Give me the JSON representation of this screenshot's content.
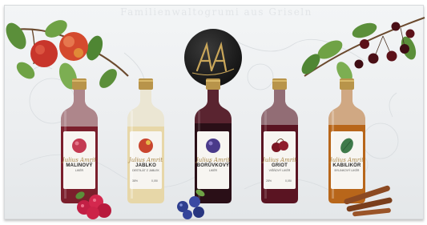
{
  "box": {
    "top_text": "Familienwaltogrumi aus Griseln",
    "logo_text": "AA"
  },
  "bottles": [
    {
      "name": "MALINOVÝ",
      "sub": "LIKÉR",
      "pct": "",
      "volume": "",
      "liquid": "#7b1f2c",
      "fruit": "raspberry-icon"
    },
    {
      "name": "JABLKO",
      "sub": "DESTILÁT Z JABLEK",
      "pct": "38%",
      "volume": "0,05l",
      "liquid": "#e7d7a8",
      "fruit": "apple-icon"
    },
    {
      "name": "BORŮVKOVÝ",
      "sub": "LIKÉR",
      "pct": "",
      "volume": "",
      "liquid": "#2a0f17",
      "fruit": "blueberry-icon"
    },
    {
      "name": "GRIOT",
      "sub": "VIŠŇOVÝ LIKÉR",
      "pct": "28%",
      "volume": "0,05l",
      "liquid": "#5a1422",
      "fruit": "cherry-icon"
    },
    {
      "name": "KABILIKÖR",
      "sub": "BYLINKOVÝ LIKÉR",
      "pct": "",
      "volume": "",
      "liquid": "#b8661a",
      "fruit": "herb-leaf-icon"
    }
  ],
  "signature": "Julius Amrit",
  "colors": {
    "box": "#eef0f2",
    "cap_gold": "#b8944a",
    "logo_circle": "#161616"
  }
}
